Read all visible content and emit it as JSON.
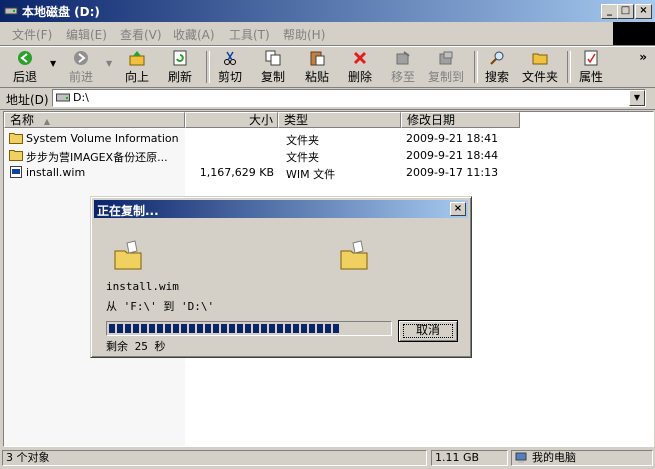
{
  "window": {
    "title": "本地磁盘 (D:)",
    "min": "_",
    "max": "□",
    "close": "×"
  },
  "menu": [
    "文件(F)",
    "编辑(E)",
    "查看(V)",
    "收藏(A)",
    "工具(T)",
    "帮助(H)"
  ],
  "toolbar": {
    "back": "后退",
    "forward": "前进",
    "up": "向上",
    "refresh": "刷新",
    "cut": "剪切",
    "copy": "复制",
    "paste": "粘贴",
    "delete": "删除",
    "move_to": "移至",
    "copy_to": "复制到",
    "search": "搜索",
    "folders": "文件夹",
    "properties": "属性",
    "more": "»"
  },
  "address": {
    "label": "地址(D)",
    "value": "D:\\"
  },
  "columns": {
    "name": "名称",
    "size": "大小",
    "type": "类型",
    "modified": "修改日期"
  },
  "files": [
    {
      "name": "System Volume Information",
      "size": "",
      "type": "文件夹",
      "modified": "2009-9-21 18:41"
    },
    {
      "name": "步步为营IMAGEX备份还原...",
      "size": "",
      "type": "文件夹",
      "modified": "2009-9-21 18:44"
    },
    {
      "name": "install.wim",
      "size": "1,167,629 KB",
      "type": "WIM 文件",
      "modified": "2009-9-17 11:13"
    }
  ],
  "status": {
    "count": "3 个对象",
    "size": "1.11 GB",
    "location": "我的电脑"
  },
  "dialog": {
    "title": "正在复制...",
    "close": "×",
    "filename": "install.wim",
    "fromto": "从 'F:\\' 到 'D:\\'",
    "remaining": "剩余 25 秒",
    "cancel": "取消",
    "progress": 0.82
  }
}
